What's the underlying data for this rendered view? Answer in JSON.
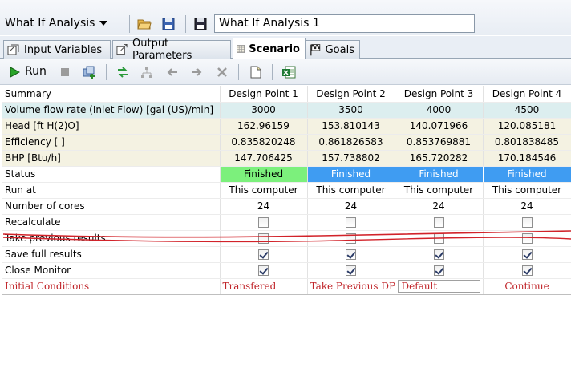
{
  "toolbar": {
    "analysis_dropdown": "What If Analysis",
    "analysis_name": "What If Analysis 1"
  },
  "tabs": [
    {
      "label": "Input Variables"
    },
    {
      "label": "Output Parameters"
    },
    {
      "label": "Scenario"
    },
    {
      "label": "Goals"
    }
  ],
  "actions": {
    "run_label": "Run"
  },
  "grid": {
    "header": [
      "Summary",
      "Design Point 1",
      "Design Point 2",
      "Design Point 3",
      "Design Point 4"
    ],
    "input_rows": [
      {
        "label": "Volume flow rate (Inlet Flow) [gal (US)/min]",
        "values": [
          "3000",
          "3500",
          "4000",
          "4500"
        ]
      }
    ],
    "output_rows": [
      {
        "label": "Head [ft H(2)O]",
        "values": [
          "162.96159",
          "153.810143",
          "140.071966",
          "120.085181"
        ]
      },
      {
        "label": "Efficiency [ ]",
        "values": [
          "0.835820248",
          "0.861826583",
          "0.853769881",
          "0.801838485"
        ]
      },
      {
        "label": "BHP [Btu/h]",
        "values": [
          "147.706425",
          "157.738802",
          "165.720282",
          "170.184546"
        ]
      }
    ],
    "status": {
      "label": "Status",
      "values": [
        "Finished",
        "Finished",
        "Finished",
        "Finished"
      ]
    },
    "run_at": {
      "label": "Run at",
      "values": [
        "This computer",
        "This computer",
        "This computer",
        "This computer"
      ]
    },
    "cores": {
      "label": "Number of cores",
      "values": [
        "24",
        "24",
        "24",
        "24"
      ]
    },
    "recalculate": {
      "label": "Recalculate",
      "checked": [
        false,
        false,
        false,
        false
      ]
    },
    "take_previous": {
      "label": "Take previous results",
      "checked": [
        false,
        false,
        false,
        false
      ]
    },
    "save_full": {
      "label": "Save full results",
      "checked": [
        true,
        true,
        true,
        true
      ]
    },
    "close_monitor": {
      "label": "Close Monitor",
      "checked": [
        true,
        true,
        true,
        true
      ]
    },
    "initial_conditions": {
      "label": "Initial Conditions",
      "values": [
        "Transfered",
        "Take Previous DP",
        "Default",
        "Continue"
      ]
    }
  },
  "colors": {
    "status_first": "#7cf07c",
    "status_rest": "#3f9cf2",
    "annotation_red": "#c0252a",
    "input_row_bg": "#dceeef",
    "output_row_bg": "#f4f2e2"
  }
}
